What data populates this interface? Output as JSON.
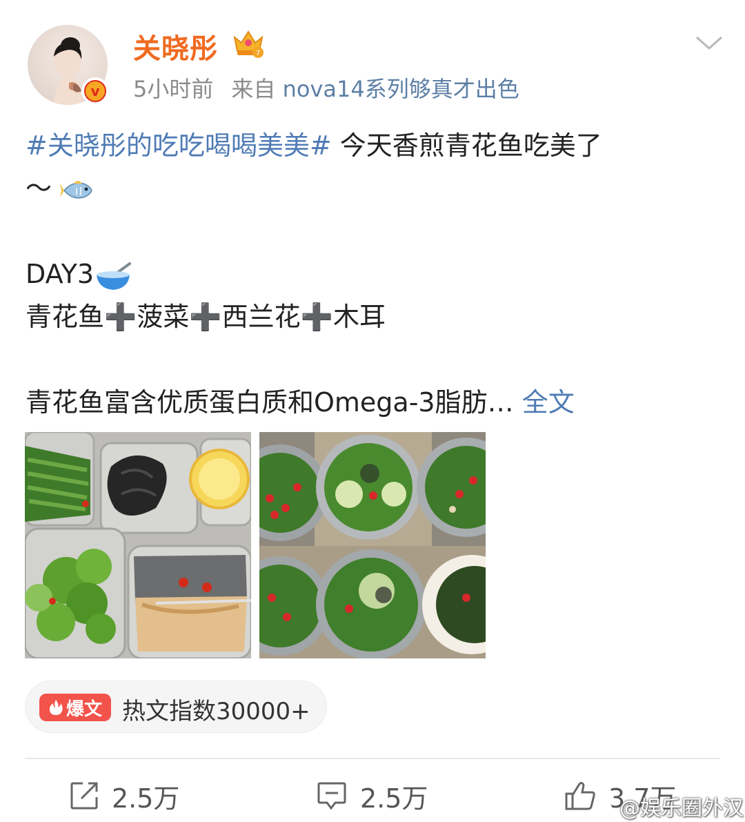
{
  "user": {
    "name": "关晓彤",
    "time": "5小时前",
    "from_label": "来自",
    "device": "nova14系列够真才出色"
  },
  "post": {
    "topic": "#关晓彤的吃吃喝喝美美#",
    "line1_rest": " 今天香煎青花鱼吃美了",
    "line2": "～",
    "day": "DAY3",
    "menu": "青花鱼➕菠菜➕西兰花➕木耳",
    "summary": "青花鱼富含优质蛋白质和Omega-3脂肪…",
    "more_label": "全文"
  },
  "hot": {
    "tag_label": "爆文",
    "text": "热文指数30000+"
  },
  "actions": {
    "repost_count": "2.5万",
    "comment_count": "2.5万",
    "like_count": "3.7万"
  },
  "watermark": "@娱乐圈外汉",
  "colors": {
    "name": "#f06a1f",
    "link": "#4f7bb5",
    "hot_tag": "#f2534a"
  }
}
